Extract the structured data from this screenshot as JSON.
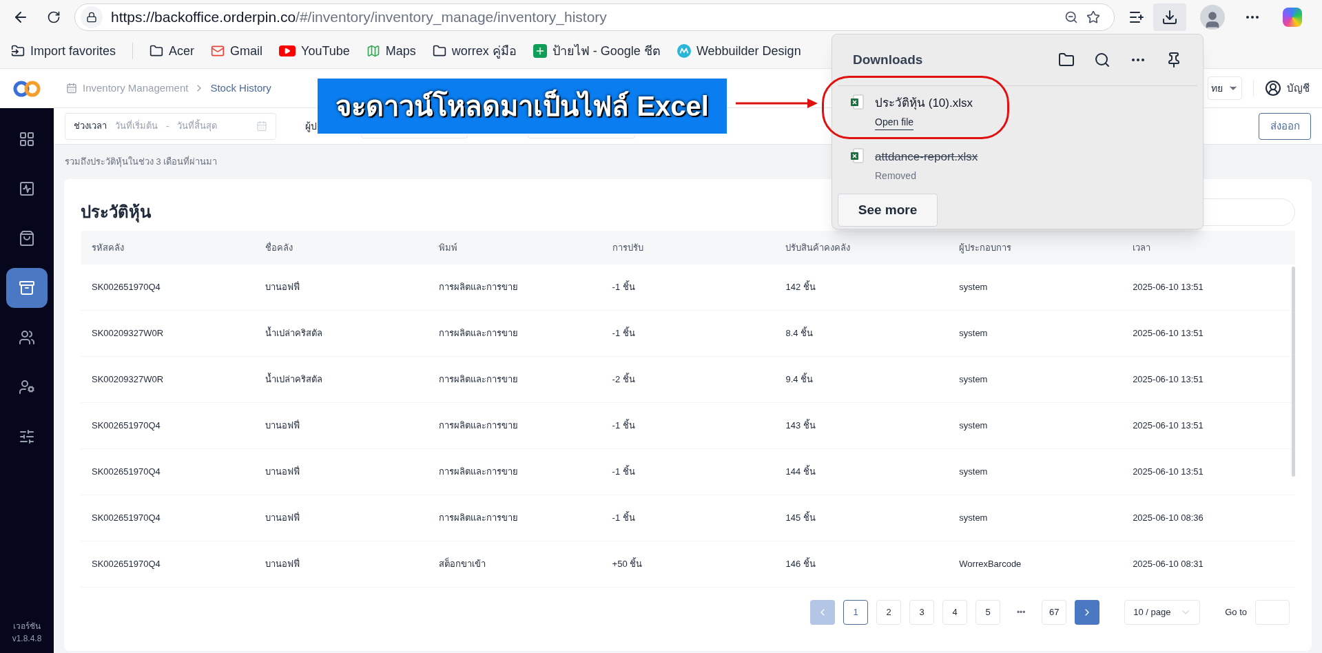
{
  "browser": {
    "url_host": "https://backoffice.orderpin.co",
    "url_path": "/#/inventory/inventory_manage/inventory_history"
  },
  "bookmarks": [
    {
      "kind": "import",
      "label": "Import favorites"
    },
    {
      "kind": "folder",
      "label": "Acer"
    },
    {
      "kind": "gmail",
      "label": "Gmail"
    },
    {
      "kind": "youtube",
      "label": "YouTube"
    },
    {
      "kind": "maps",
      "label": "Maps"
    },
    {
      "kind": "folder",
      "label": "worrex คู่มือ"
    },
    {
      "kind": "sheets",
      "label": "ป้ายไฟ - Google ชีต"
    },
    {
      "kind": "webbuilder",
      "label": "Webbuilder Design"
    }
  ],
  "downloads": {
    "title": "Downloads",
    "items": [
      {
        "name": "ประวัติหุ้น (10).xlsx",
        "status": "Open file",
        "removed": false
      },
      {
        "name": "attdance-report.xlsx",
        "status": "Removed",
        "removed": true
      }
    ],
    "see_more": "See more"
  },
  "annotation": {
    "banner": "จะดาวน์โหลดมาเป็นไฟล์ Excel"
  },
  "sidebar": {
    "items": [
      {
        "kind": "grid",
        "selected": false
      },
      {
        "kind": "activity",
        "selected": false
      },
      {
        "kind": "bag",
        "selected": false
      },
      {
        "kind": "inventory",
        "selected": true
      },
      {
        "kind": "users",
        "selected": false
      },
      {
        "kind": "user-settings",
        "selected": false
      },
      {
        "kind": "sliders",
        "selected": false
      }
    ],
    "version_label": "เวอร์ชัน",
    "version": "v1.8.4.8"
  },
  "breadcrumb": [
    "Inventory Management",
    "Stock History"
  ],
  "language": "ทย",
  "account": "บัญชี",
  "filters": {
    "period_label": "ช่วงเวลา",
    "start_placeholder": "วันที่เริ่มต้น",
    "separator": "-",
    "end_placeholder": "วันที่สิ้นสุด",
    "operator_label": "ผู้ป"
  },
  "export_button": "ส่งออก",
  "note": "รวมถึงประวัติหุ้นในช่วง 3 เดือนที่ผ่านมา",
  "card_title": "ประวัติหุ้น",
  "table": {
    "columns": [
      "รหัสคลัง",
      "ชื่อคลัง",
      "พิมพ์",
      "การปรับ",
      "ปรับสินค้าคงคลัง",
      "ผู้ประกอบการ",
      "เวลา"
    ],
    "rows": [
      [
        "SK002651970Q4",
        "บานอฟฟี่",
        "การผลิตและการขาย",
        "-1 ชิ้น",
        "142 ชิ้น",
        "system",
        "2025-06-10 13:51"
      ],
      [
        "SK00209327W0R",
        "น้ำเปล่าคริสตัล",
        "การผลิตและการขาย",
        "-1 ชิ้น",
        "8.4 ชิ้น",
        "system",
        "2025-06-10 13:51"
      ],
      [
        "SK00209327W0R",
        "น้ำเปล่าคริสตัล",
        "การผลิตและการขาย",
        "-2 ชิ้น",
        "9.4 ชิ้น",
        "system",
        "2025-06-10 13:51"
      ],
      [
        "SK002651970Q4",
        "บานอฟฟี่",
        "การผลิตและการขาย",
        "-1 ชิ้น",
        "143 ชิ้น",
        "system",
        "2025-06-10 13:51"
      ],
      [
        "SK002651970Q4",
        "บานอฟฟี่",
        "การผลิตและการขาย",
        "-1 ชิ้น",
        "144 ชิ้น",
        "system",
        "2025-06-10 13:51"
      ],
      [
        "SK002651970Q4",
        "บานอฟฟี่",
        "การผลิตและการขาย",
        "-1 ชิ้น",
        "145 ชิ้น",
        "system",
        "2025-06-10 08:36"
      ],
      [
        "SK002651970Q4",
        "บานอฟฟี่",
        "สต็อกขาเข้า",
        "+50 ชิ้น",
        "146 ชิ้น",
        "WorrexBarcode",
        "2025-06-10 08:31"
      ]
    ]
  },
  "pagination": {
    "prev_disabled": true,
    "next_disabled": false,
    "pages": [
      {
        "label": "1",
        "selected": true
      },
      {
        "label": "2",
        "selected": false
      },
      {
        "label": "3",
        "selected": false
      },
      {
        "label": "4",
        "selected": false
      },
      {
        "label": "5",
        "selected": false
      }
    ],
    "ellipsis": "•••",
    "last": "67",
    "page_size": "10 / page",
    "goto_label": "Go to"
  }
}
